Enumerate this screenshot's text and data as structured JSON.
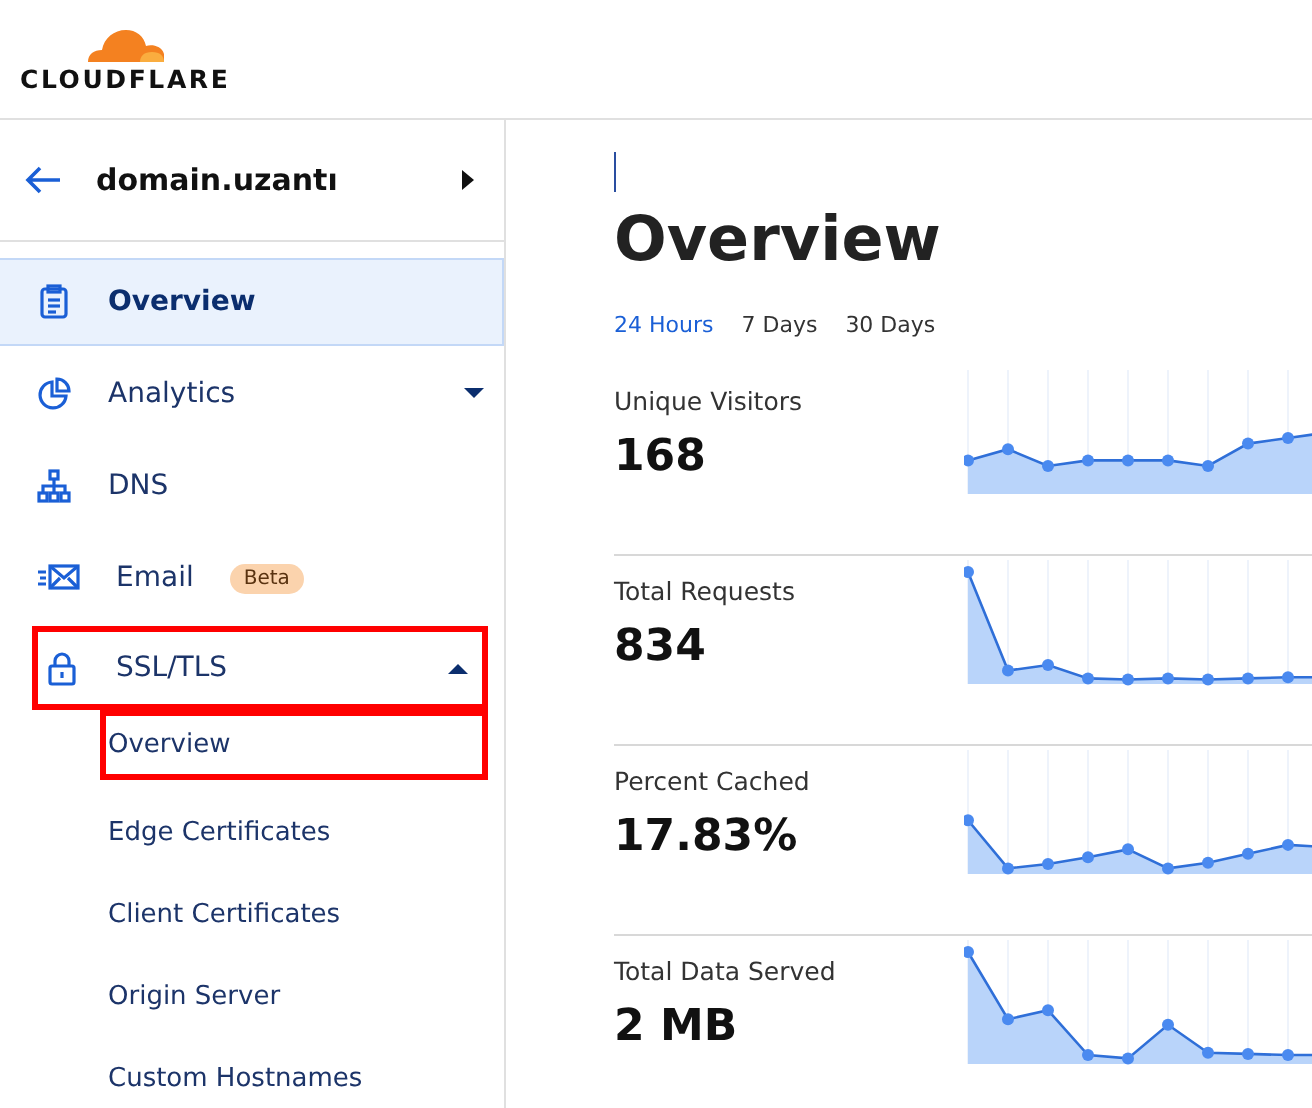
{
  "brand": {
    "name": "CLOUDFLARE"
  },
  "domain": {
    "name": "domain.uzantı"
  },
  "nav": [
    {
      "label": "Overview",
      "selected": true,
      "highlighted": false
    },
    {
      "label": "Analytics",
      "selected": false,
      "expanded": false,
      "highlighted": false
    },
    {
      "label": "DNS",
      "selected": false,
      "highlighted": false
    },
    {
      "label": "Email",
      "selected": false,
      "badge": "Beta",
      "highlighted": false
    },
    {
      "label": "SSL/TLS",
      "selected": false,
      "expanded": true,
      "highlighted": true,
      "children": [
        {
          "label": "Overview",
          "highlighted": true
        },
        {
          "label": "Edge Certificates",
          "highlighted": false
        },
        {
          "label": "Client Certificates",
          "highlighted": false
        },
        {
          "label": "Origin Server",
          "highlighted": false
        },
        {
          "label": "Custom Hostnames",
          "highlighted": false
        }
      ]
    }
  ],
  "page": {
    "title": "Overview"
  },
  "ranges": [
    {
      "label": "24 Hours",
      "selected": true
    },
    {
      "label": "7 Days",
      "selected": false
    },
    {
      "label": "30 Days",
      "selected": false
    }
  ],
  "metrics": [
    {
      "label": "Unique Visitors",
      "value": "168"
    },
    {
      "label": "Total Requests",
      "value": "834"
    },
    {
      "label": "Percent Cached",
      "value": "17.83%"
    },
    {
      "label": "Total Data Served",
      "value": "2 MB"
    }
  ]
}
